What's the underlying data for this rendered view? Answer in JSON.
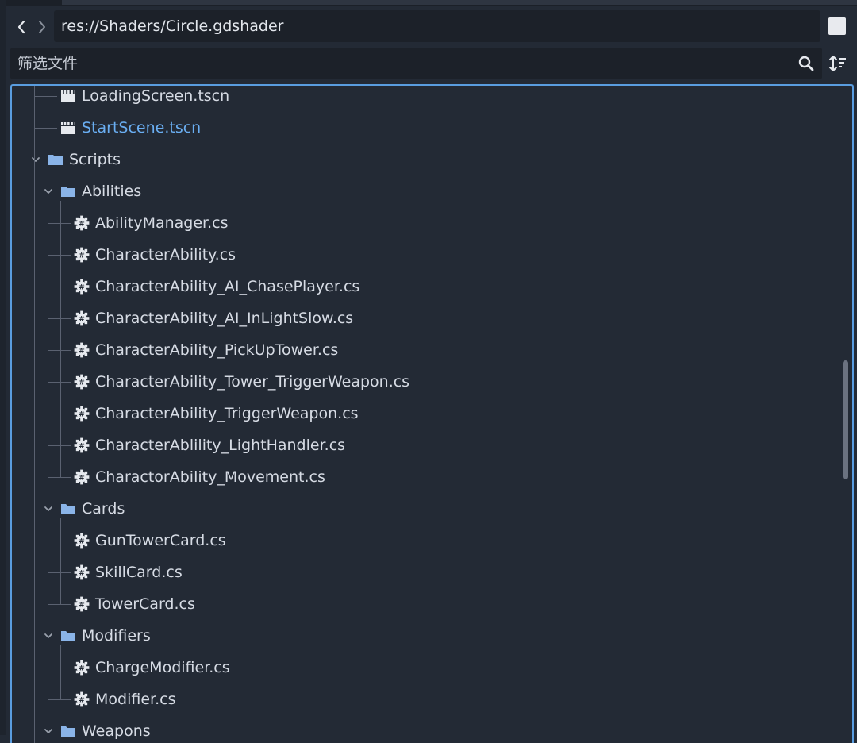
{
  "nav": {
    "back_icon": "chevron-left-icon",
    "forward_icon": "chevron-right-icon",
    "path": "res://Shaders/Circle.gdshader"
  },
  "filter": {
    "placeholder": "筛选文件",
    "search_icon": "search-icon",
    "sort_icon": "sort-icon"
  },
  "colors": {
    "accent": "#5a9de0",
    "active_file": "#6aaef2",
    "folder": "#8ab4e8",
    "background": "#232a35",
    "field": "#1c2129"
  },
  "tree": {
    "items": [
      {
        "type": "scene",
        "label": "LoadingScreen.tscn",
        "depth": 2
      },
      {
        "type": "scene",
        "label": "StartScene.tscn",
        "depth": 2,
        "active": true
      },
      {
        "type": "folder",
        "label": "Scripts",
        "depth": 1,
        "expanded": true
      },
      {
        "type": "folder",
        "label": "Abilities",
        "depth": 2,
        "expanded": true
      },
      {
        "type": "script",
        "label": "AbilityManager.cs",
        "depth": 3
      },
      {
        "type": "script",
        "label": "CharacterAbility.cs",
        "depth": 3
      },
      {
        "type": "script",
        "label": "CharacterAbility_AI_ChasePlayer.cs",
        "depth": 3
      },
      {
        "type": "script",
        "label": "CharacterAbility_AI_InLightSlow.cs",
        "depth": 3
      },
      {
        "type": "script",
        "label": "CharacterAbility_PickUpTower.cs",
        "depth": 3
      },
      {
        "type": "script",
        "label": "CharacterAbility_Tower_TriggerWeapon.cs",
        "depth": 3
      },
      {
        "type": "script",
        "label": "CharacterAbility_TriggerWeapon.cs",
        "depth": 3
      },
      {
        "type": "script",
        "label": "CharacterAblility_LightHandler.cs",
        "depth": 3
      },
      {
        "type": "script",
        "label": "CharactorAbility_Movement.cs",
        "depth": 3
      },
      {
        "type": "folder",
        "label": "Cards",
        "depth": 2,
        "expanded": true
      },
      {
        "type": "script",
        "label": "GunTowerCard.cs",
        "depth": 3
      },
      {
        "type": "script",
        "label": "SkillCard.cs",
        "depth": 3
      },
      {
        "type": "script",
        "label": "TowerCard.cs",
        "depth": 3
      },
      {
        "type": "folder",
        "label": "Modifiers",
        "depth": 2,
        "expanded": true
      },
      {
        "type": "script",
        "label": "ChargeModifier.cs",
        "depth": 3
      },
      {
        "type": "script",
        "label": "Modifier.cs",
        "depth": 3
      },
      {
        "type": "folder",
        "label": "Weapons",
        "depth": 2,
        "expanded": true
      }
    ]
  }
}
